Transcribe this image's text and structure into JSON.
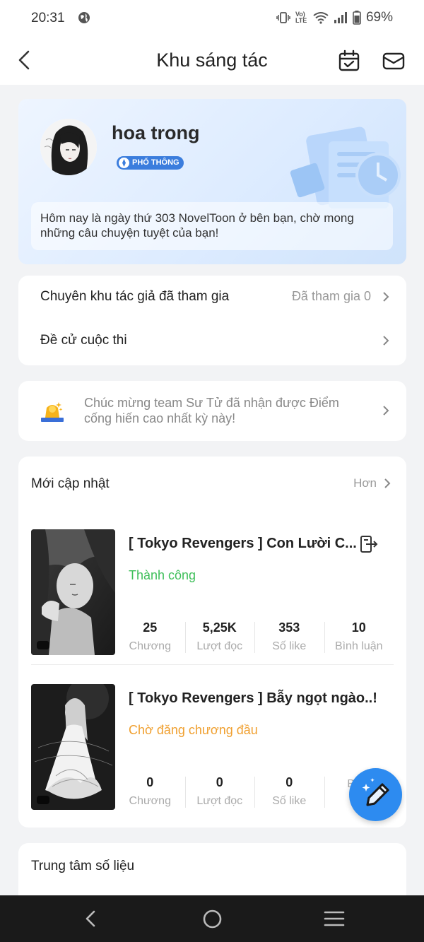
{
  "status_bar": {
    "time": "20:31",
    "battery": "69%",
    "network": "Vo) LTE"
  },
  "header": {
    "title": "Khu sáng tác",
    "left_icon": "chevron-left-icon",
    "icons": [
      "calendar-check-icon",
      "mail-icon"
    ]
  },
  "profile": {
    "name": "hoa trong",
    "badge": "PHỔ THÔNG",
    "greeting": "Hôm nay là ngày thứ 303 NovelToon ở bên bạn, chờ mong những câu chuyện tuyệt của bạn!"
  },
  "menu": {
    "items": [
      {
        "label": "Chuyên khu tác giả đã tham gia",
        "value": "Đã tham gia 0"
      },
      {
        "label": "Đề cử cuộc thi",
        "value": ""
      }
    ]
  },
  "notice": {
    "text": "Chúc mừng team Sư Tử đã nhận được Điểm cống hiến cao nhất kỳ này!",
    "icon": "trophy-icon"
  },
  "recent": {
    "title": "Mới cập nhật",
    "more": "Hơn",
    "books": [
      {
        "title": "[ Tokyo Revengers ] Con Lười C...",
        "status": "Thành công",
        "stats": [
          {
            "value": "25",
            "label": "Chương"
          },
          {
            "value": "5,25K",
            "label": "Lượt đọc"
          },
          {
            "value": "353",
            "label": "Số like"
          },
          {
            "value": "10",
            "label": "Bình luận"
          }
        ]
      },
      {
        "title": "[ Tokyo Revengers ] Bẫy ngọt ngào..!",
        "status": "Chờ đăng chương đầu",
        "stats": [
          {
            "value": "0",
            "label": "Chương"
          },
          {
            "value": "0",
            "label": "Lượt đọc"
          },
          {
            "value": "0",
            "label": "Số like"
          },
          {
            "value": "",
            "label": "Bình"
          }
        ]
      }
    ]
  },
  "data_center": {
    "title": "Trung tâm số liệu"
  },
  "colors": {
    "success": "#3fbf5a",
    "pending": "#f0a030",
    "accent": "#2d8bf0",
    "badge": "#3b7ddd"
  }
}
